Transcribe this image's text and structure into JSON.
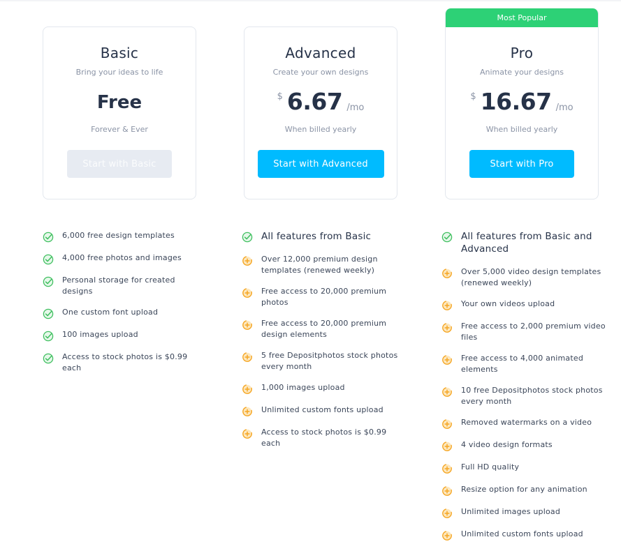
{
  "plans": [
    {
      "id": "basic",
      "name": "Basic",
      "tagline": "Bring your ideas to life",
      "price_label": "Free",
      "price_note": "Forever & Ever",
      "cta_label": "Start with Basic",
      "cta_disabled": true
    },
    {
      "id": "advanced",
      "name": "Advanced",
      "tagline": "Create your own designs",
      "currency": "$",
      "amount": "6.67",
      "period": "/mo",
      "price_note": "When billed yearly",
      "cta_label": "Start with Advanced"
    },
    {
      "id": "pro",
      "badge": "Most Popular",
      "name": "Pro",
      "tagline": "Animate your designs",
      "currency": "$",
      "amount": "16.67",
      "period": "/mo",
      "price_note": "When billed yearly",
      "cta_label": "Start with Pro"
    }
  ],
  "features": {
    "basic": [
      {
        "icon": "check-circle-icon",
        "text": "6,000 free design templates"
      },
      {
        "icon": "check-circle-icon",
        "text": "4,000 free photos and images"
      },
      {
        "icon": "check-circle-icon",
        "text": "Personal storage for created designs"
      },
      {
        "icon": "check-circle-icon",
        "text": "One custom font upload"
      },
      {
        "icon": "check-circle-icon",
        "text": "100 images upload"
      },
      {
        "icon": "check-circle-icon",
        "text": "Access to stock photos is $0.99 each"
      }
    ],
    "advanced": [
      {
        "icon": "check-circle-icon",
        "text": "All features from Basic",
        "heading": true
      },
      {
        "icon": "plus-circle-icon",
        "text": "Over 12,000 premium design templates (renewed weekly)"
      },
      {
        "icon": "plus-circle-icon",
        "text": "Free access to 20,000 premium photos"
      },
      {
        "icon": "plus-circle-icon",
        "text": "Free access to 20,000 premium design elements"
      },
      {
        "icon": "plus-circle-icon",
        "text": "5 free Depositphotos stock photos every month"
      },
      {
        "icon": "plus-circle-icon",
        "text": "1,000 images upload"
      },
      {
        "icon": "plus-circle-icon",
        "text": "Unlimited custom fonts upload"
      },
      {
        "icon": "plus-circle-icon",
        "text": "Access to stock photos is $0.99 each"
      }
    ],
    "pro": [
      {
        "icon": "check-circle-icon",
        "text": "All features from Basic and Advanced",
        "heading": true
      },
      {
        "icon": "plus-circle-icon",
        "text": "Over 5,000 video design templates (renewed weekly)"
      },
      {
        "icon": "plus-circle-icon",
        "text": "Your own videos upload"
      },
      {
        "icon": "plus-circle-icon",
        "text": "Free access to 2,000 premium video files"
      },
      {
        "icon": "plus-circle-icon",
        "text": "Free access to 4,000 animated elements"
      },
      {
        "icon": "plus-circle-icon",
        "text": "10 free Depositphotos stock photos every month"
      },
      {
        "icon": "plus-circle-icon",
        "text": "Removed watermarks on a video"
      },
      {
        "icon": "plus-circle-icon",
        "text": "4 video design formats"
      },
      {
        "icon": "plus-circle-icon",
        "text": "Full HD quality"
      },
      {
        "icon": "plus-circle-icon",
        "text": "Resize option for any animation"
      },
      {
        "icon": "plus-circle-icon",
        "text": "Unlimited images upload"
      },
      {
        "icon": "plus-circle-icon",
        "text": "Unlimited custom fonts upload"
      }
    ]
  },
  "colors": {
    "badge": "#2dd176",
    "cta": "#00bbff",
    "cta_disabled": "#e7ebf2",
    "check": "#3fbf5f",
    "plus": "#f5a623",
    "heading_text": "#263248",
    "muted_text": "#8a93a5"
  }
}
